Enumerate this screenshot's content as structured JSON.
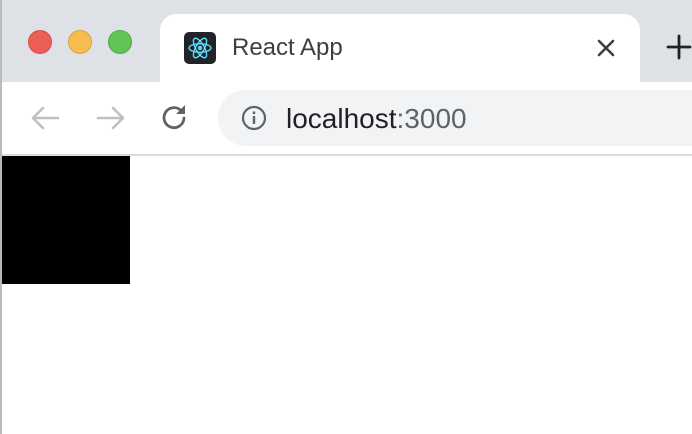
{
  "window_controls": {
    "close_color": "#ec5f57",
    "minimize_color": "#f5bd4f",
    "zoom_color": "#61c454"
  },
  "tab": {
    "title": "React App",
    "favicon": "react-logo-icon",
    "close_icon": "close-icon"
  },
  "tabstrip": {
    "new_tab_icon": "plus-icon"
  },
  "toolbar": {
    "back_icon": "arrow-left-icon",
    "forward_icon": "arrow-right-icon",
    "reload_icon": "reload-icon",
    "site_info_icon": "info-icon"
  },
  "address_bar": {
    "host": "localhost",
    "port": ":3000"
  },
  "page": {
    "box_color": "#000000"
  }
}
